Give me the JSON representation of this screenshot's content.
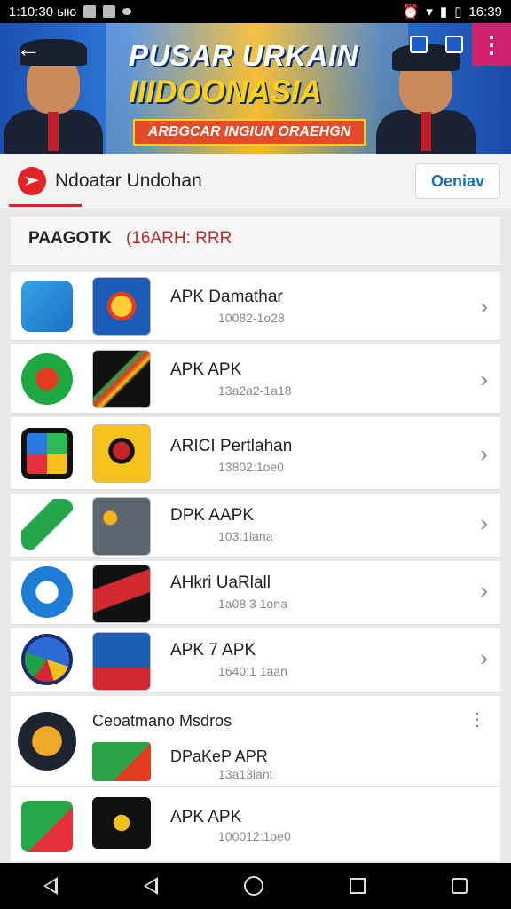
{
  "statusbar": {
    "time_left": "1:10:30 ыю",
    "time_right": "16:39"
  },
  "banner": {
    "title_line1": "PUSAR URKAIN",
    "title_line2": "IIIDOONASIA",
    "subtitle": "ARBGCAR INGIUN ORAEHGN"
  },
  "tabbar": {
    "title": "Ndoatar Undohan",
    "button_label": "Oeniav"
  },
  "list_header": {
    "label": "PAAGOTK",
    "code": "(16ARH: RRR"
  },
  "apps": [
    {
      "title": "APK Damathar",
      "date": "10082-1o28"
    },
    {
      "title": "APK APK",
      "date": "13a2a2-1a18"
    },
    {
      "title": "ARICI Pertlahan",
      "date": "13802:1oe0"
    },
    {
      "title": "DPK AAPK",
      "date": "103:1lana"
    },
    {
      "title": "AHkri UaRlall",
      "date": "1a08 3 1ona"
    },
    {
      "title": "APK 7 APK",
      "date": "1640:1 1aan"
    }
  ],
  "group": {
    "title": "Ceoatmano Msdros",
    "items": [
      {
        "title": "DPaKeP APR",
        "date": "13a13lant"
      },
      {
        "title": "APK APK",
        "date": "100012:1oe0"
      }
    ]
  },
  "icons": {
    "back": "arrow-left-icon",
    "menu": "overflow-menu-icon",
    "chevron": "chevron-right-icon"
  }
}
